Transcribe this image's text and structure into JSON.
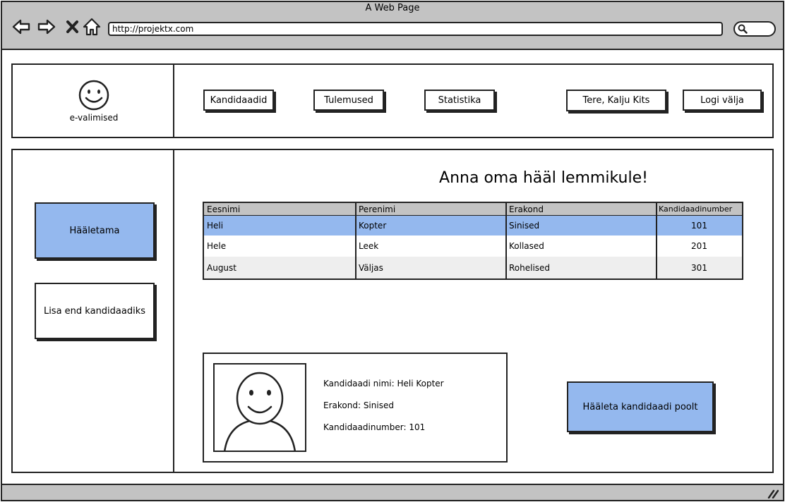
{
  "browser": {
    "title": "A Web Page",
    "url": "http://projektx.com",
    "icons": [
      "back-arrow-icon",
      "forward-arrow-icon",
      "close-x-icon",
      "home-icon",
      "search-icon",
      "resize-grip-icon"
    ]
  },
  "header": {
    "logo_text": "e-valimised",
    "nav": {
      "kandidaadid": "Kandidaadid",
      "tulemused": "Tulemused",
      "statistika": "Statistika"
    },
    "greeting": "Tere, Kalju Kits",
    "logout": "Logi välja"
  },
  "sidebar": {
    "vote": "Hääletama",
    "register": "Lisa end kandidaadiks"
  },
  "main": {
    "heading": "Anna oma hääl lemmikule!",
    "table": {
      "headers": [
        "Eesnimi",
        "Perenimi",
        "Erakond",
        "Kandidaadinumber"
      ],
      "rows": [
        [
          "Heli",
          "Kopter",
          "Sinised",
          "101"
        ],
        [
          "Hele",
          "Leek",
          "Kollased",
          "201"
        ],
        [
          "August",
          "Väljas",
          "Rohelised",
          "301"
        ]
      ]
    },
    "card": {
      "name": "Kandidaadi nimi: Heli Kopter",
      "party": "Erakond: Sinised",
      "number": "Kandidaadinumber: 101"
    },
    "vote_button": "Hääleta kandidaadi poolt"
  },
  "colors": {
    "accent": "#94b8ee",
    "chrome": "#c3c3c3",
    "border": "#222222"
  }
}
